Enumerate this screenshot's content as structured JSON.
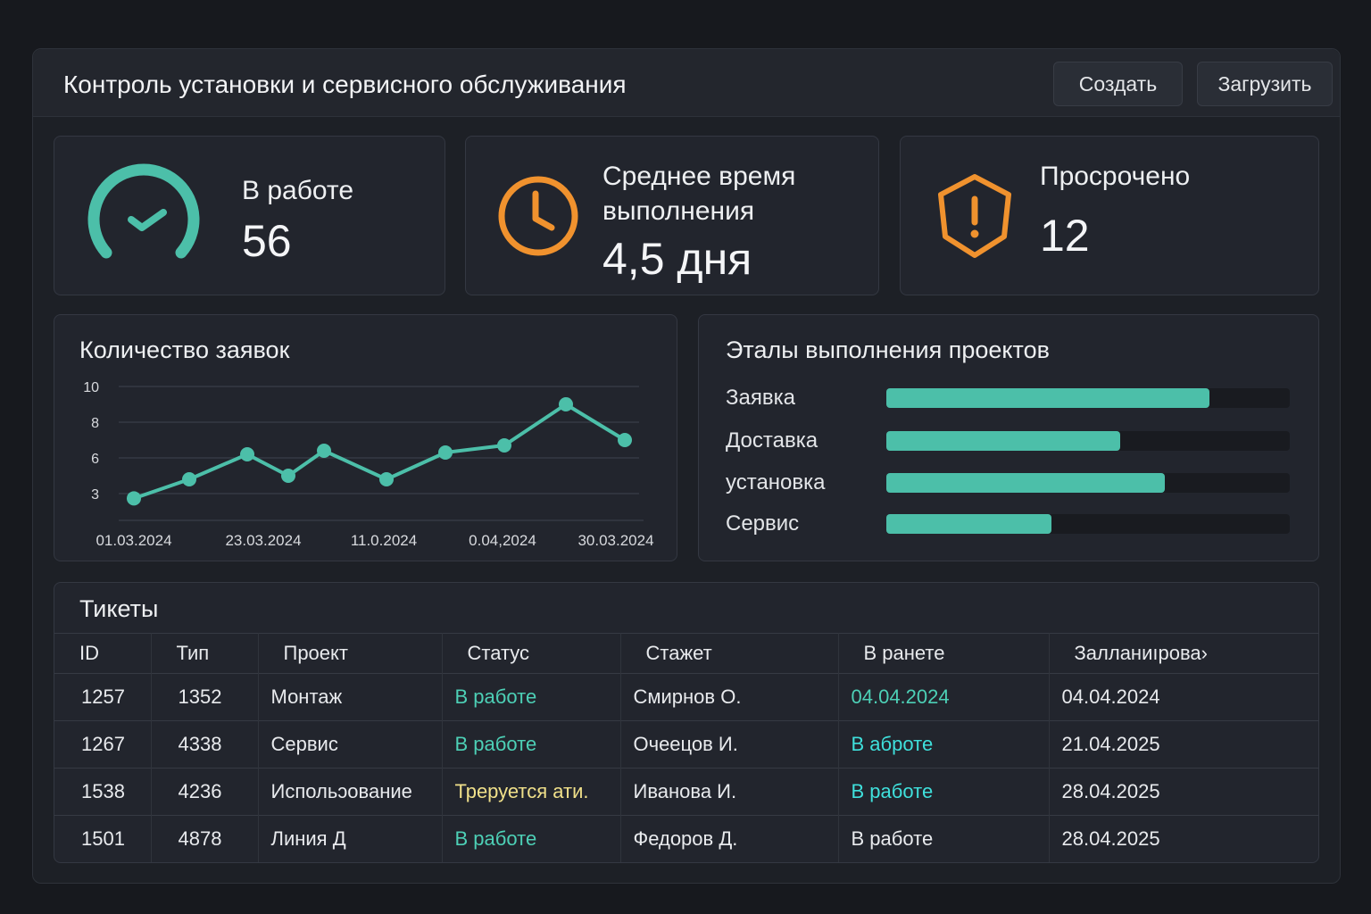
{
  "header": {
    "title": "Контроль установки и сервисного обслуживания",
    "create_label": "Создать",
    "upload_label": "Загрузить"
  },
  "kpis": [
    {
      "label": "В работе",
      "value": "56",
      "icon": "gauge-check-icon"
    },
    {
      "label_line1": "Среднее время",
      "label_line2": "выполнения",
      "value": "4,5 дня",
      "icon": "clock-icon"
    },
    {
      "label": "Просрочено",
      "value": "12",
      "icon": "warning-hexagon-icon"
    }
  ],
  "colors": {
    "accent": "#4cbfa9",
    "orange": "#f0922e",
    "warning": "#f0e08a"
  },
  "chart_data": {
    "type": "line",
    "title": "Количество заявок",
    "yticks": [
      3,
      6,
      8,
      10
    ],
    "xticks": [
      "01.03.2024",
      "23.03.2024",
      "11.0.2024",
      "0.04,2024",
      "30.03.2024"
    ],
    "values": [
      2.6,
      4.2,
      6.2,
      4.5,
      6.4,
      4.2,
      6.3,
      6.7,
      9,
      7
    ],
    "grid": true
  },
  "stages": {
    "title": "Эталы выполнения проектов",
    "items": [
      {
        "label": "Заявка",
        "progress": 80
      },
      {
        "label": "Доставка",
        "progress": 58
      },
      {
        "label": "установка",
        "progress": 69
      },
      {
        "label": "Сервис",
        "progress": 41
      }
    ]
  },
  "tickets": {
    "title": "Тикеты",
    "columns": [
      "ID",
      "Тип",
      "Проект",
      "Статус",
      "Стажет",
      "В ранете",
      "Залланиıрова›"
    ],
    "rows": [
      [
        "1257",
        "1352",
        "Монтаж",
        "В работе",
        "Смирнов О.",
        "04.04.2024",
        "04.04.2024"
      ],
      [
        "1267",
        "4338",
        "Сервис",
        "В работе",
        "Очеецов И.",
        "В аброте",
        "21.04.2025"
      ],
      [
        "1538",
        "4236",
        "Испольɔование",
        "Треруется ати.",
        "Иванова И.",
        "В работе",
        "28.04.2025"
      ],
      [
        "1501",
        "4878",
        "Линия Д",
        "В работе",
        "Федоров Д.",
        "В работе",
        "28.04.2025"
      ]
    ]
  }
}
